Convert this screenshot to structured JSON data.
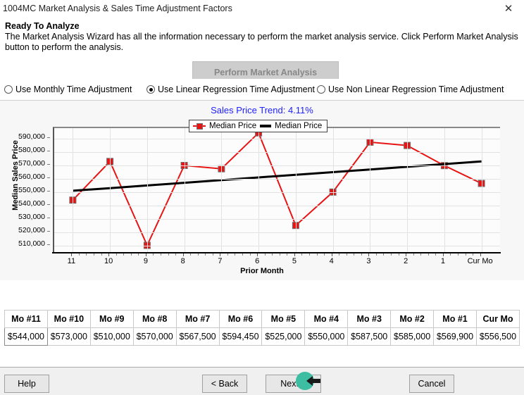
{
  "window": {
    "title": "1004MC Market Analysis & Sales Time Adjustment Factors",
    "close_label": "✕"
  },
  "instruction": {
    "heading": "Ready To Analyze",
    "line1": "The Market Analysis Wizard has all the information necessary to perform the market analysis service.  Click Perform Market Analysis",
    "line2": "button to perform the analysis.",
    "perform_button": "Perform Market Analysis"
  },
  "radios": [
    {
      "label": "Use Monthly Time Adjustment",
      "selected": false
    },
    {
      "label": "Use Linear Regression Time Adjustment",
      "selected": true
    },
    {
      "label": "Use Non Linear Regression Time Adjustment",
      "selected": false
    }
  ],
  "chart_data": {
    "type": "line",
    "title": "Sales Price Trend: 4.11%",
    "title_color": "#2121ff",
    "xlabel": "Prior Month",
    "ylabel": "Median Sales Price",
    "categories": [
      "11",
      "10",
      "9",
      "8",
      "7",
      "6",
      "5",
      "4",
      "3",
      "2",
      "1",
      "Cur Mo"
    ],
    "yticks": [
      "590,000",
      "580,000",
      "570,000",
      "560,000",
      "550,000",
      "540,000",
      "530,000",
      "520,000",
      "510,000"
    ],
    "ytick_values": [
      590000,
      580000,
      570000,
      560000,
      550000,
      540000,
      530000,
      520000,
      510000
    ],
    "ylim": [
      505000,
      598000
    ],
    "grid": true,
    "legend_position": "top-center",
    "legend": [
      {
        "label": "Median Price",
        "marker": "square-line",
        "color": "#e81414"
      },
      {
        "label": "Median Price",
        "marker": "line",
        "color": "#000000"
      }
    ],
    "series": [
      {
        "name": "Median Price",
        "type": "line-marker",
        "color": "#e81414",
        "values": [
          544000,
          573000,
          510000,
          570000,
          567500,
          594450,
          525000,
          550000,
          587500,
          585000,
          569900,
          556500
        ]
      },
      {
        "name": "Median Price",
        "type": "trend-line",
        "color": "#000000",
        "values": [
          551000,
          553000,
          555000,
          557000,
          559000,
          561000,
          563000,
          565000,
          567000,
          569000,
          571000,
          573000
        ]
      }
    ]
  },
  "table": {
    "headers": [
      "Mo #11",
      "Mo #10",
      "Mo #9",
      "Mo #8",
      "Mo #7",
      "Mo #6",
      "Mo #5",
      "Mo #4",
      "Mo #3",
      "Mo #2",
      "Mo #1",
      "Cur Mo"
    ],
    "values": [
      "$544,000",
      "$573,000",
      "$510,000",
      "$570,000",
      "$567,500",
      "$594,450",
      "$525,000",
      "$550,000",
      "$587,500",
      "$585,000",
      "$569,900",
      "$556,500"
    ]
  },
  "footer": {
    "help": "Help",
    "back": "< Back",
    "next": "Next >",
    "cancel": "Cancel"
  }
}
